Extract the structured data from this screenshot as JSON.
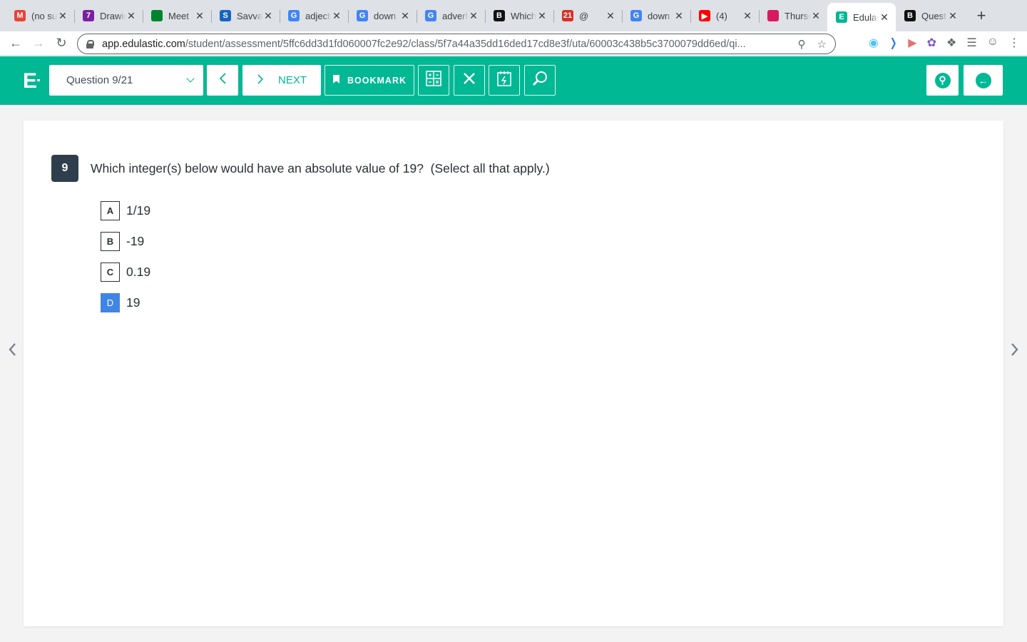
{
  "browser": {
    "tabs": [
      {
        "title": "(no subject)",
        "favicon": "gmail-icon",
        "color": "#ea4335",
        "glyph": "M",
        "active": false
      },
      {
        "title": "Drawings",
        "favicon": "drawings-icon",
        "color": "#7b1fa2",
        "glyph": "7",
        "active": false
      },
      {
        "title": "Meet",
        "favicon": "meet-icon",
        "color": "#00832d",
        "glyph": "",
        "active": false
      },
      {
        "title": "Savvas",
        "favicon": "savvas-icon",
        "color": "#1565c0",
        "glyph": "S",
        "active": false
      },
      {
        "title": "adjective",
        "favicon": "google-icon",
        "color": "#4285f4",
        "glyph": "G",
        "active": false
      },
      {
        "title": "down",
        "favicon": "google-icon",
        "color": "#4285f4",
        "glyph": "G",
        "active": false
      },
      {
        "title": "adverb",
        "favicon": "google-icon",
        "color": "#4285f4",
        "glyph": "G",
        "active": false
      },
      {
        "title": "Which",
        "favicon": "brainly-icon",
        "color": "#111111",
        "glyph": "B",
        "active": false
      },
      {
        "title": "@",
        "favicon": "calendar-icon",
        "color": "#d93025",
        "glyph": "21",
        "active": false
      },
      {
        "title": "down",
        "favicon": "google-icon",
        "color": "#4285f4",
        "glyph": "G",
        "active": false
      },
      {
        "title": "(4)",
        "favicon": "youtube-icon",
        "color": "#ff0000",
        "glyph": "▶",
        "active": false
      },
      {
        "title": "Thursday",
        "favicon": "classroom-icon",
        "color": "#d81b60",
        "glyph": "",
        "active": false
      },
      {
        "title": "Edulastic",
        "favicon": "edulastic-icon",
        "color": "#00b894",
        "glyph": "E",
        "active": true
      },
      {
        "title": "Question",
        "favicon": "brainly-icon",
        "color": "#111111",
        "glyph": "B",
        "active": false
      }
    ],
    "new_tab": "+",
    "url_host": "app.edulastic.com",
    "url_path": "/student/assessment/5ffc6dd3d1fd060007fc2e92/class/5f7a44a35dd16ded17cd8e3f/uta/60003c438b5c3700079dd6ed/qi..."
  },
  "header": {
    "logo": "E",
    "question_select": "Question 9/21",
    "prev_label": "<",
    "next_label": "NEXT",
    "bookmark_label": "BOOKMARK"
  },
  "question": {
    "number": "9",
    "text": "Which integer(s) below would have an absolute value of 19?  (Select all that apply.)",
    "options": [
      {
        "letter": "A",
        "label": "1/19",
        "selected": false
      },
      {
        "letter": "B",
        "label": "-19",
        "selected": false
      },
      {
        "letter": "C",
        "label": "0.19",
        "selected": false
      },
      {
        "letter": "D",
        "label": "19",
        "selected": true
      }
    ]
  },
  "colors": {
    "brand": "#00b894",
    "selected": "#3f85e5",
    "question_badge": "#2f3e4c"
  }
}
